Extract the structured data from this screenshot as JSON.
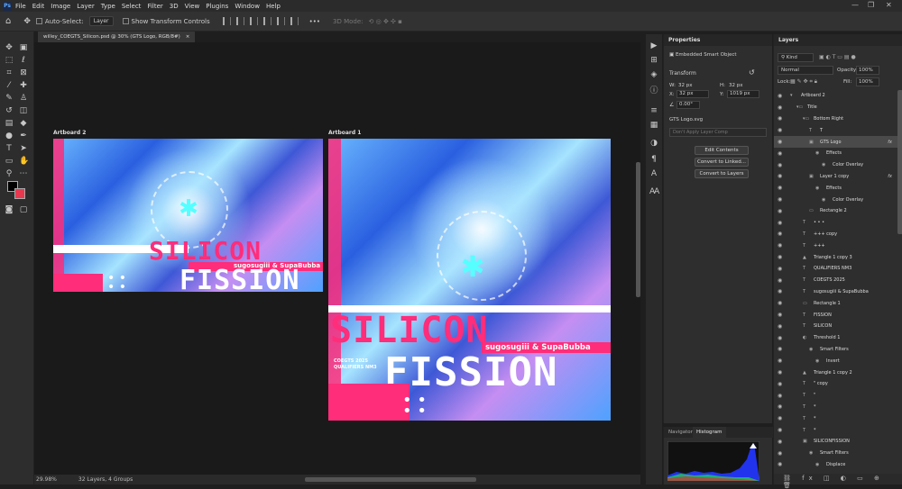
{
  "menu": {
    "app_badge": "Ps",
    "items": [
      "File",
      "Edit",
      "Image",
      "Layer",
      "Type",
      "Select",
      "Filter",
      "3D",
      "View",
      "Plugins",
      "Window",
      "Help"
    ],
    "window_controls": [
      "—",
      "❐",
      "✕"
    ]
  },
  "options": {
    "auto_select_label": "Auto-Select:",
    "auto_select_value": "Layer",
    "show_transform_label": "Show Transform Controls",
    "mode_3d_label": "3D Mode:",
    "more_label": "•••"
  },
  "document": {
    "tab_title": "willey_COEGTS_Silicon.psd @ 30% (GTS Logo, RGB/8#)",
    "close_glyph": "×"
  },
  "artboards": {
    "a2_label": "Artboard 2",
    "a1_label": "Artboard 1",
    "title_word1": "SILICON",
    "title_word2": "FISSION",
    "credit": "sugosugiii & SupaBubba",
    "small_line1": "COEGTS 2025",
    "small_line2": "QUALIFIERS NM3"
  },
  "status": {
    "zoom": "29.98%",
    "info": "32 Layers, 4 Groups"
  },
  "properties": {
    "title": "Properties",
    "type_label": "Embedded Smart Object",
    "transform_label": "Transform",
    "w_label": "W:",
    "w_value": "32 px",
    "h_label": "H:",
    "h_value": "32 px",
    "x_label": "X:",
    "x_value": "32 px",
    "y_label": "Y:",
    "y_value": "1019 px",
    "angle_value": "0.00°",
    "file_name": "GTS Logo.svg",
    "layer_comp_placeholder": "Don't Apply Layer Comp",
    "btn_edit": "Edit Contents",
    "btn_linked": "Convert to Linked...",
    "btn_layers": "Convert to Layers"
  },
  "navigator": {
    "tab_nav": "Navigator",
    "tab_hist": "Histogram"
  },
  "layers_panel": {
    "title": "Layers",
    "kind_label": "Kind",
    "blend_mode": "Normal",
    "opacity_label": "Opacity:",
    "opacity_value": "100%",
    "lock_label": "Lock:",
    "fill_label": "Fill:",
    "fill_value": "100%",
    "rows": [
      {
        "name": "Artboard 2",
        "indent": 0,
        "icon": "▾",
        "eye": true,
        "fx": ""
      },
      {
        "name": "Title",
        "indent": 1,
        "icon": "▾▭",
        "eye": true,
        "fx": ""
      },
      {
        "name": "Bottom Right",
        "indent": 2,
        "icon": "▾▭",
        "eye": true,
        "fx": ""
      },
      {
        "name": "T",
        "indent": 3,
        "icon": "T",
        "eye": true,
        "fx": ""
      },
      {
        "name": "GTS Logo",
        "indent": 3,
        "icon": "▣",
        "eye": true,
        "fx": "fx",
        "selected": true
      },
      {
        "name": "Effects",
        "indent": 4,
        "icon": "◉",
        "eye": true,
        "fx": ""
      },
      {
        "name": "Color Overlay",
        "indent": 5,
        "icon": "◉",
        "eye": true,
        "fx": ""
      },
      {
        "name": "Layer 1 copy",
        "indent": 3,
        "icon": "▣",
        "eye": true,
        "fx": "fx"
      },
      {
        "name": "Effects",
        "indent": 4,
        "icon": "◉",
        "eye": true,
        "fx": ""
      },
      {
        "name": "Color Overlay",
        "indent": 5,
        "icon": "◉",
        "eye": true,
        "fx": ""
      },
      {
        "name": "Rectangle 2",
        "indent": 3,
        "icon": "▭",
        "eye": true,
        "fx": ""
      },
      {
        "name": "• • •",
        "indent": 2,
        "icon": "T",
        "eye": true,
        "fx": ""
      },
      {
        "name": "+++ copy",
        "indent": 2,
        "icon": "T",
        "eye": true,
        "fx": ""
      },
      {
        "name": "+++",
        "indent": 2,
        "icon": "T",
        "eye": true,
        "fx": ""
      },
      {
        "name": "Triangle 1 copy 3",
        "indent": 2,
        "icon": "▲",
        "eye": true,
        "fx": ""
      },
      {
        "name": "QUALIFIERS NM3",
        "indent": 2,
        "icon": "T",
        "eye": true,
        "fx": ""
      },
      {
        "name": "COEGTS 2025",
        "indent": 2,
        "icon": "T",
        "eye": true,
        "fx": ""
      },
      {
        "name": "sugosugiii & SupaBubba",
        "indent": 2,
        "icon": "T",
        "eye": true,
        "fx": ""
      },
      {
        "name": "Rectangle 1",
        "indent": 2,
        "icon": "▭",
        "eye": true,
        "fx": ""
      },
      {
        "name": "FISSION",
        "indent": 2,
        "icon": "T",
        "eye": true,
        "fx": ""
      },
      {
        "name": "SILICON",
        "indent": 2,
        "icon": "T",
        "eye": true,
        "fx": ""
      },
      {
        "name": "Threshold 1",
        "indent": 2,
        "icon": "◐",
        "eye": true,
        "fx": ""
      },
      {
        "name": "Smart Filters",
        "indent": 3,
        "icon": "◉",
        "eye": true,
        "fx": ""
      },
      {
        "name": "Invert",
        "indent": 4,
        "icon": "◉",
        "eye": true,
        "fx": ""
      },
      {
        "name": "Triangle 1 copy 2",
        "indent": 2,
        "icon": "▲",
        "eye": true,
        "fx": ""
      },
      {
        "name": "\" copy",
        "indent": 2,
        "icon": "T",
        "eye": true,
        "fx": ""
      },
      {
        "name": "\"",
        "indent": 2,
        "icon": "T",
        "eye": true,
        "fx": ""
      },
      {
        "name": "*",
        "indent": 2,
        "icon": "T",
        "eye": true,
        "fx": ""
      },
      {
        "name": "*",
        "indent": 2,
        "icon": "T",
        "eye": true,
        "fx": ""
      },
      {
        "name": "*",
        "indent": 2,
        "icon": "T",
        "eye": true,
        "fx": ""
      },
      {
        "name": "SILICONFISSION",
        "indent": 2,
        "icon": "▣",
        "eye": true,
        "fx": ""
      },
      {
        "name": "Smart Filters",
        "indent": 3,
        "icon": "◉",
        "eye": true,
        "fx": ""
      },
      {
        "name": "Displace",
        "indent": 4,
        "icon": "◉",
        "eye": true,
        "fx": ""
      },
      {
        "name": "Displace",
        "indent": 4,
        "icon": "◉",
        "eye": true,
        "fx": ""
      }
    ]
  },
  "colors": {
    "accent_pink": "#ff2d7a",
    "fg_swatch": "#000000",
    "bg_swatch": "#e8384f"
  }
}
